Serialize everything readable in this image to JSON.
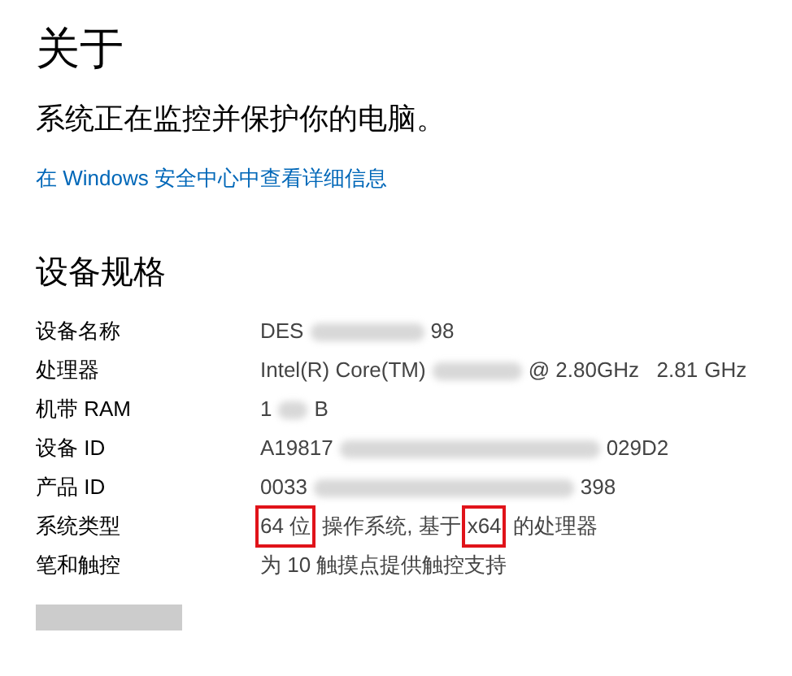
{
  "title": "关于",
  "status_text": "系统正在监控并保护你的电脑。",
  "security_link": "在 Windows 安全中心中查看详细信息",
  "specs_heading": "设备规格",
  "specs": [
    {
      "label": "设备名称",
      "value": [
        {
          "kind": "text",
          "text": "DES"
        },
        {
          "kind": "blur_m"
        },
        {
          "kind": "text",
          "text": "98"
        }
      ]
    },
    {
      "label": "处理器",
      "value": [
        {
          "kind": "text",
          "text": "Intel(R) Core(TM)"
        },
        {
          "kind": "blur_p"
        },
        {
          "kind": "text",
          "text": "@ 2.80GHz   2.81"
        },
        {
          "kind": "text",
          "text": "GHz"
        }
      ]
    },
    {
      "label": "机带 RAM",
      "value": [
        {
          "kind": "text",
          "text": "1"
        },
        {
          "kind": "blur_s"
        },
        {
          "kind": "text",
          "text": "B"
        }
      ]
    },
    {
      "label": "设备 ID",
      "value": [
        {
          "kind": "text",
          "text": "A19817"
        },
        {
          "kind": "blur_l"
        },
        {
          "kind": "text",
          "text": "029D2"
        }
      ]
    },
    {
      "label": "产品 ID",
      "value": [
        {
          "kind": "text",
          "text": "0033"
        },
        {
          "kind": "blur_l"
        },
        {
          "kind": "text",
          "text": "398"
        }
      ]
    },
    {
      "label": "系统类型",
      "value": [
        {
          "kind": "text",
          "text": "64 位",
          "highlighted": true
        },
        {
          "kind": "text",
          "text": "操作系统, 基于"
        },
        {
          "kind": "text",
          "text": "x64",
          "highlighted": true
        },
        {
          "kind": "text",
          "text": "的处理器"
        }
      ]
    },
    {
      "label": "笔和触控",
      "value": [
        {
          "kind": "text",
          "text": "为 10 触摸点提供触控支持"
        }
      ]
    }
  ]
}
